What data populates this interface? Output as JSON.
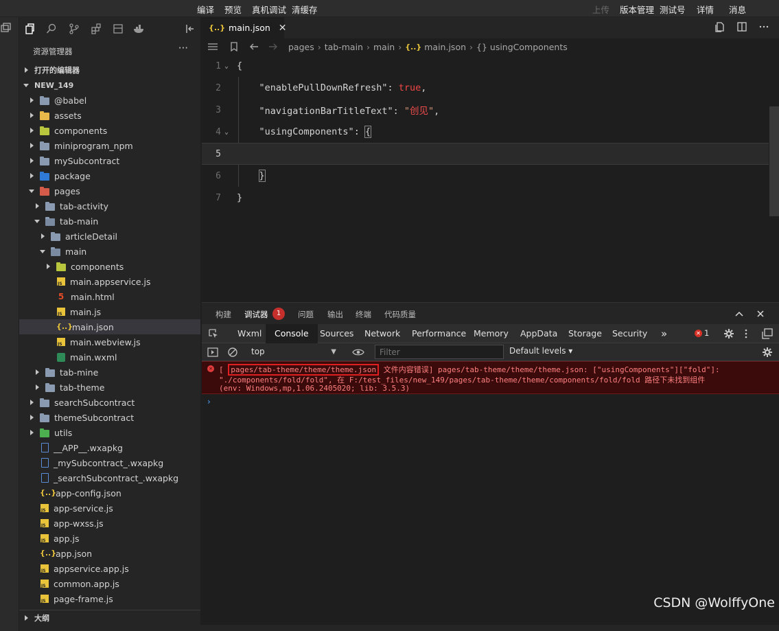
{
  "topbar": {
    "items": [
      "编译",
      "预览",
      "真机调试",
      "清缓存"
    ],
    "right_items": [
      {
        "label": "上传",
        "dim": true
      },
      {
        "label": "版本管理",
        "dim": false
      },
      {
        "label": "测试号",
        "dim": false
      },
      {
        "label": "详情",
        "dim": false
      },
      {
        "label": "消息",
        "dim": false
      }
    ]
  },
  "sidebar": {
    "title": "资源管理器",
    "more": "···",
    "open_editors": "打开的编辑器",
    "project": "NEW_149",
    "outline": "大纲",
    "tree": [
      {
        "label": "@babel",
        "depth": 1,
        "tw": "r",
        "icon": "folder"
      },
      {
        "label": "assets",
        "depth": 1,
        "tw": "r",
        "icon": "folder-y"
      },
      {
        "label": "components",
        "depth": 1,
        "tw": "r",
        "icon": "folder-g"
      },
      {
        "label": "miniprogram_npm",
        "depth": 1,
        "tw": "r",
        "icon": "folder"
      },
      {
        "label": "mySubcontract",
        "depth": 1,
        "tw": "r",
        "icon": "folder"
      },
      {
        "label": "package",
        "depth": 1,
        "tw": "r",
        "icon": "folder-b"
      },
      {
        "label": "pages",
        "depth": 1,
        "tw": "d",
        "icon": "folder-r"
      },
      {
        "label": "tab-activity",
        "depth": 2,
        "tw": "r",
        "icon": "folder"
      },
      {
        "label": "tab-main",
        "depth": 2,
        "tw": "d",
        "icon": "folder-open"
      },
      {
        "label": "articleDetail",
        "depth": 3,
        "tw": "r",
        "icon": "folder"
      },
      {
        "label": "main",
        "depth": 3,
        "tw": "d",
        "icon": "folder-open"
      },
      {
        "label": "components",
        "depth": 4,
        "tw": "r",
        "icon": "folder-g"
      },
      {
        "label": "main.appservice.js",
        "depth": 4,
        "tw": "",
        "icon": "js"
      },
      {
        "label": "main.html",
        "depth": 4,
        "tw": "",
        "icon": "html"
      },
      {
        "label": "main.js",
        "depth": 4,
        "tw": "",
        "icon": "js"
      },
      {
        "label": "main.json",
        "depth": 4,
        "tw": "",
        "icon": "json",
        "selected": true
      },
      {
        "label": "main.webview.js",
        "depth": 4,
        "tw": "",
        "icon": "js"
      },
      {
        "label": "main.wxml",
        "depth": 4,
        "tw": "",
        "icon": "wxml"
      },
      {
        "label": "tab-mine",
        "depth": 2,
        "tw": "r",
        "icon": "folder"
      },
      {
        "label": "tab-theme",
        "depth": 2,
        "tw": "r",
        "icon": "folder"
      },
      {
        "label": "searchSubcontract",
        "depth": 1,
        "tw": "r",
        "icon": "folder"
      },
      {
        "label": "themeSubcontract",
        "depth": 1,
        "tw": "r",
        "icon": "folder"
      },
      {
        "label": "utils",
        "depth": 1,
        "tw": "r",
        "icon": "folder-gr"
      },
      {
        "label": "__APP__.wxapkg",
        "depth": 1,
        "tw": "",
        "icon": "pkg"
      },
      {
        "label": "_mySubcontract_.wxapkg",
        "depth": 1,
        "tw": "",
        "icon": "pkg"
      },
      {
        "label": "_searchSubcontract_.wxapkg",
        "depth": 1,
        "tw": "",
        "icon": "pkg"
      },
      {
        "label": "app-config.json",
        "depth": 1,
        "tw": "",
        "icon": "json"
      },
      {
        "label": "app-service.js",
        "depth": 1,
        "tw": "",
        "icon": "js"
      },
      {
        "label": "app-wxss.js",
        "depth": 1,
        "tw": "",
        "icon": "js"
      },
      {
        "label": "app.js",
        "depth": 1,
        "tw": "",
        "icon": "js"
      },
      {
        "label": "app.json",
        "depth": 1,
        "tw": "",
        "icon": "json"
      },
      {
        "label": "appservice.app.js",
        "depth": 1,
        "tw": "",
        "icon": "js"
      },
      {
        "label": "common.app.js",
        "depth": 1,
        "tw": "",
        "icon": "js"
      },
      {
        "label": "page-frame.js",
        "depth": 1,
        "tw": "",
        "icon": "js"
      }
    ]
  },
  "editor": {
    "tab_label": "main.json",
    "tab_icon_text": "{..}",
    "tab_close": "✕",
    "breadcrumb": [
      "pages",
      "tab-main",
      "main",
      "main.json",
      "{} usingComponents"
    ],
    "breadcrumb_icon_text": "{..}",
    "lines": [
      {
        "n": "1",
        "fold": "⌄",
        "parts": [
          {
            "t": "{",
            "c": "br"
          }
        ]
      },
      {
        "n": "2",
        "fold": "",
        "parts": [
          {
            "t": "    "
          },
          {
            "t": "\"enablePullDownRefresh\"",
            "c": "k"
          },
          {
            "t": ": "
          },
          {
            "t": "true",
            "c": "kw"
          },
          {
            "t": ","
          }
        ]
      },
      {
        "n": "3",
        "fold": "",
        "parts": [
          {
            "t": "    "
          },
          {
            "t": "\"navigationBarTitleText\"",
            "c": "k"
          },
          {
            "t": ": "
          },
          {
            "t": "\"",
            "c": "s"
          },
          {
            "t": "创见",
            "c": "cn"
          },
          {
            "t": "\"",
            "c": "s"
          },
          {
            "t": ","
          }
        ]
      },
      {
        "n": "4",
        "fold": "⌄",
        "parts": [
          {
            "t": "    "
          },
          {
            "t": "\"usingComponents\"",
            "c": "k"
          },
          {
            "t": ": "
          },
          {
            "t": "{",
            "c": "br hl"
          }
        ]
      },
      {
        "n": "5",
        "fold": "",
        "cur": true,
        "parts": [
          {
            "t": ""
          }
        ]
      },
      {
        "n": "6",
        "fold": "",
        "parts": [
          {
            "t": "    "
          },
          {
            "t": "}",
            "c": "br hl"
          }
        ]
      },
      {
        "n": "7",
        "fold": "",
        "parts": [
          {
            "t": "}",
            "c": "br"
          }
        ]
      }
    ]
  },
  "panel": {
    "tabs": [
      "构建",
      "调试器",
      "问题",
      "输出",
      "终端",
      "代码质量"
    ],
    "debugger_badge": "1",
    "devtools_tabs": [
      "Wxml",
      "Console",
      "Sources",
      "Network",
      "Performance",
      "Memory",
      "AppData",
      "Storage",
      "Security"
    ],
    "more_tabs": "»",
    "error_count": "1",
    "context": "top",
    "filter_placeholder": "Filter",
    "levels": "Default levels ▾",
    "error": {
      "line1_pre": "[ ",
      "path": "pages/tab-theme/theme/theme.json",
      "line1_post": " 文件内容错误] pages/tab-theme/theme/theme.json: [\"usingComponents\"][\"fold\"]:",
      "line2": "\"./components/fold/fold\", 在 F:/test_files/new_149/pages/tab-theme/theme/components/fold/fold 路径下未找到组件",
      "line3": "(env: Windows,mp,1.06.2405020; lib: 3.5.3)"
    },
    "prompt": "›"
  },
  "watermark": "CSDN @WolffyOne",
  "colors": {
    "error_text": "#ff8080",
    "error_bg": "#3b0a0a",
    "highlight_box": "#e02020",
    "badge": "#c5302c"
  }
}
